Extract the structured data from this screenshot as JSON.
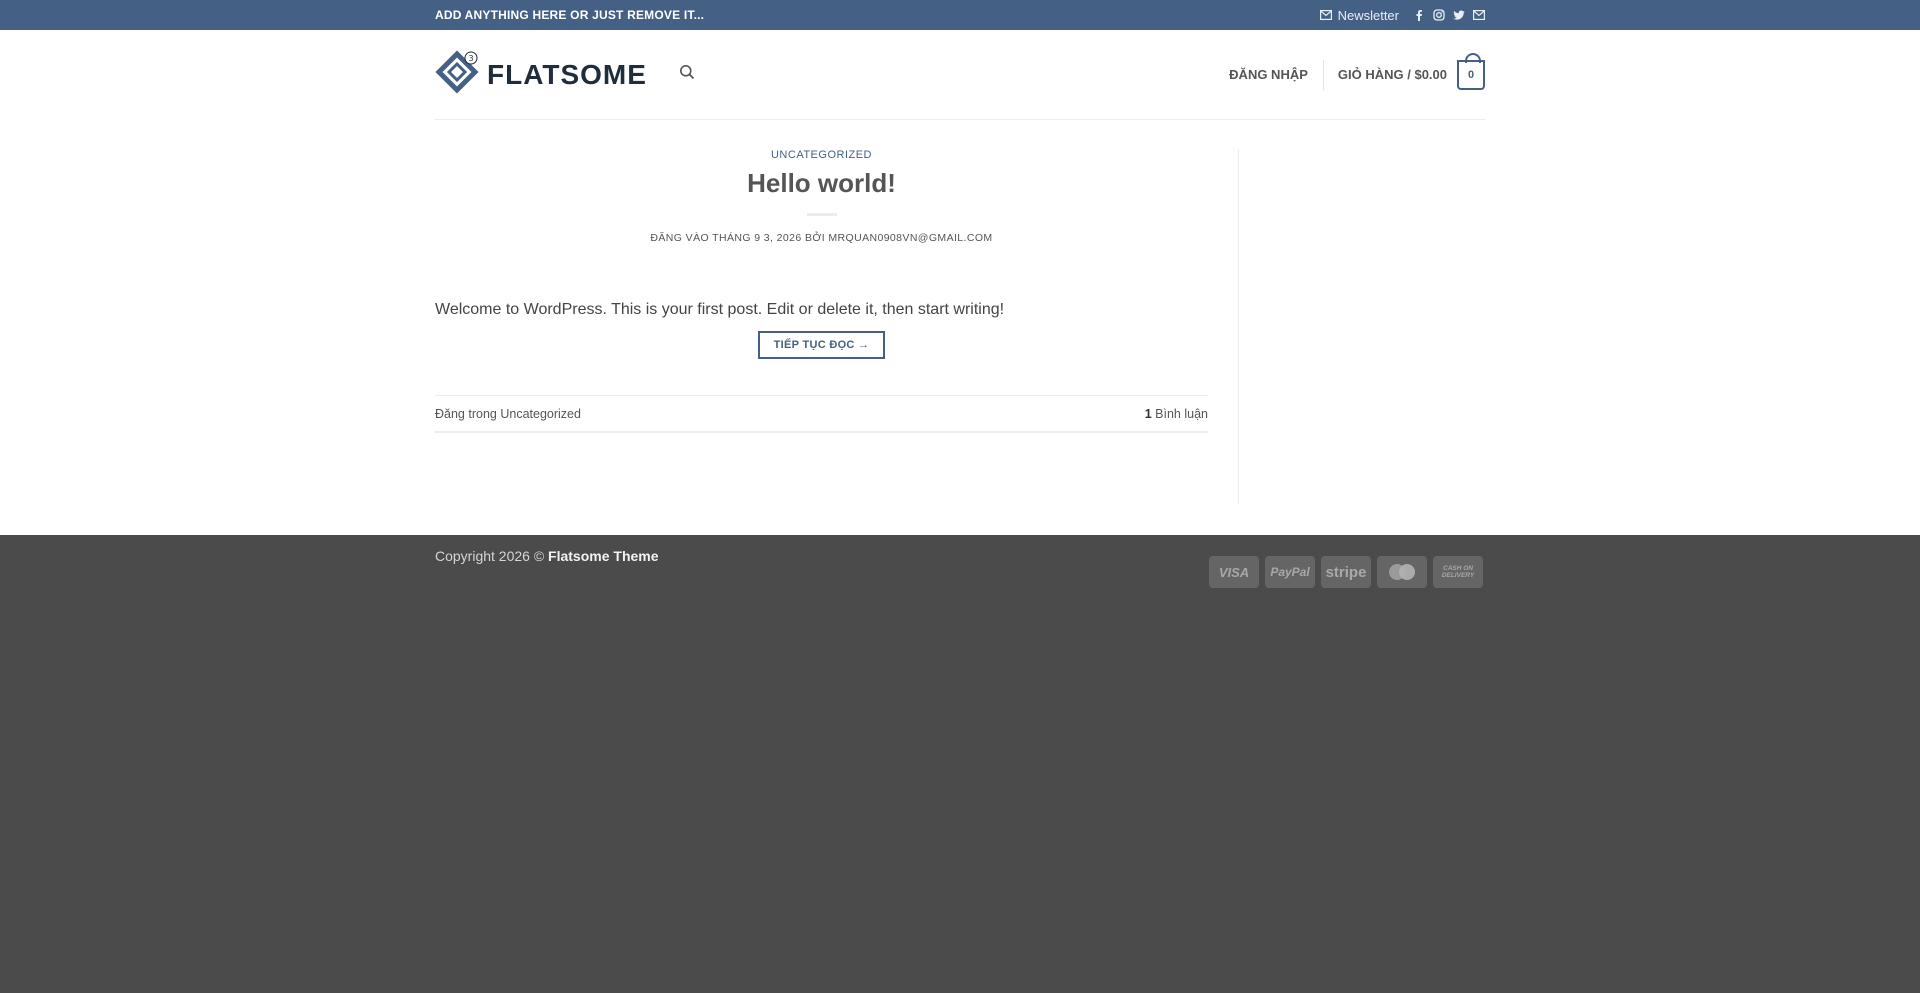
{
  "topbar": {
    "text": "ADD ANYTHING HERE OR JUST REMOVE IT...",
    "newsletter": "Newsletter",
    "socials": [
      "facebook-icon",
      "instagram-icon",
      "twitter-icon",
      "email-icon"
    ]
  },
  "header": {
    "logo_text": "FLATSOME",
    "login": "ĐĂNG NHẬP",
    "cart_label": "GIỎ HÀNG / $0.00",
    "cart_count": "0"
  },
  "post": {
    "category": "UNCATEGORIZED",
    "title": "Hello world!",
    "meta": "ĐĂNG VÀO THÁNG 9 3, 2026 BỞI MRQUAN0908VN@GMAIL.COM",
    "excerpt": "Welcome to WordPress. This is your first post. Edit or delete it, then start writing!",
    "read_more": "TIẾP TỤC ĐỌC →",
    "footer_left_prefix": "Đăng trong",
    "footer_left_category": "Uncategorized",
    "comment_count": "1",
    "comment_label": "Bình luận"
  },
  "footer": {
    "copyright_prefix": "Copyright 2026 ©",
    "copyright_brand": "Flatsome Theme",
    "payments": [
      "VISA",
      "PayPal",
      "stripe",
      "",
      "CASH ON DELIVERY"
    ]
  },
  "colors": {
    "primary": "#446084",
    "footer_bg": "#4b4b4b"
  }
}
